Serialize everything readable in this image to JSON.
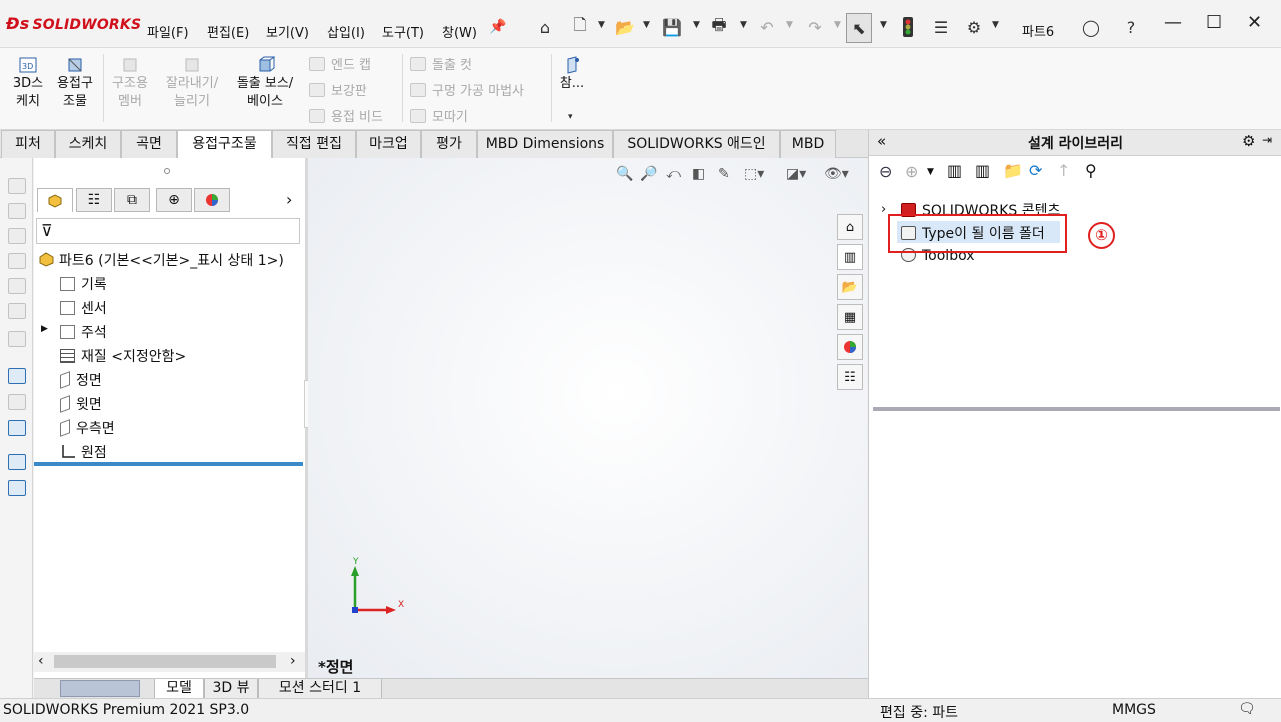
{
  "app": {
    "logo": "SOLIDWORKS",
    "doc_title": "파트6"
  },
  "menu": [
    "파일(F)",
    "편집(E)",
    "보기(V)",
    "삽입(I)",
    "도구(T)",
    "창(W)"
  ],
  "commands": {
    "sketch3d": [
      "3D스",
      "케치"
    ],
    "weldment": [
      "용접구",
      "조물"
    ],
    "struct_member": [
      "구조용",
      "멤버"
    ],
    "trim_extend": [
      "잘라내기/",
      "늘리기"
    ],
    "boss_base": [
      "돌출 보스/",
      "베이스"
    ],
    "end_cap": "엔드 캡",
    "gusset": "보강판",
    "weld_bead": "용접 비드",
    "extruded_cut": "돌출 컷",
    "hole_wizard": "구멍 가공 마법사",
    "chamfer": "모따기",
    "reference": "참..."
  },
  "tabs": [
    "피처",
    "스케치",
    "곡면",
    "용접구조물",
    "직접 편집",
    "마크업",
    "평가",
    "MBD Dimensions",
    "SOLIDWORKS 애드인",
    "MBD"
  ],
  "active_tab": "용접구조물",
  "feature_tree": {
    "root": "파트6  (기본<<기본>_표시 상태 1>)",
    "items": [
      "기록",
      "센서",
      "주석",
      "재질 <지정안함>",
      "정면",
      "윗면",
      "우측면",
      "원점"
    ]
  },
  "viewport": {
    "view_name": "*정면",
    "axis_x": "X",
    "axis_y": "Y"
  },
  "bottom_tabs": [
    "모델",
    "3D 뷰",
    "모션 스터디 1"
  ],
  "design_library": {
    "title": "설계 라이브러리",
    "items": [
      "SOLIDWORKS 콘텐츠",
      "Type이 될 이름 폴더",
      "Toolbox"
    ],
    "annotation": "①"
  },
  "status": {
    "product": "SOLIDWORKS Premium 2021 SP3.0",
    "editing": "편집 중: 파트",
    "units": "MMGS"
  }
}
